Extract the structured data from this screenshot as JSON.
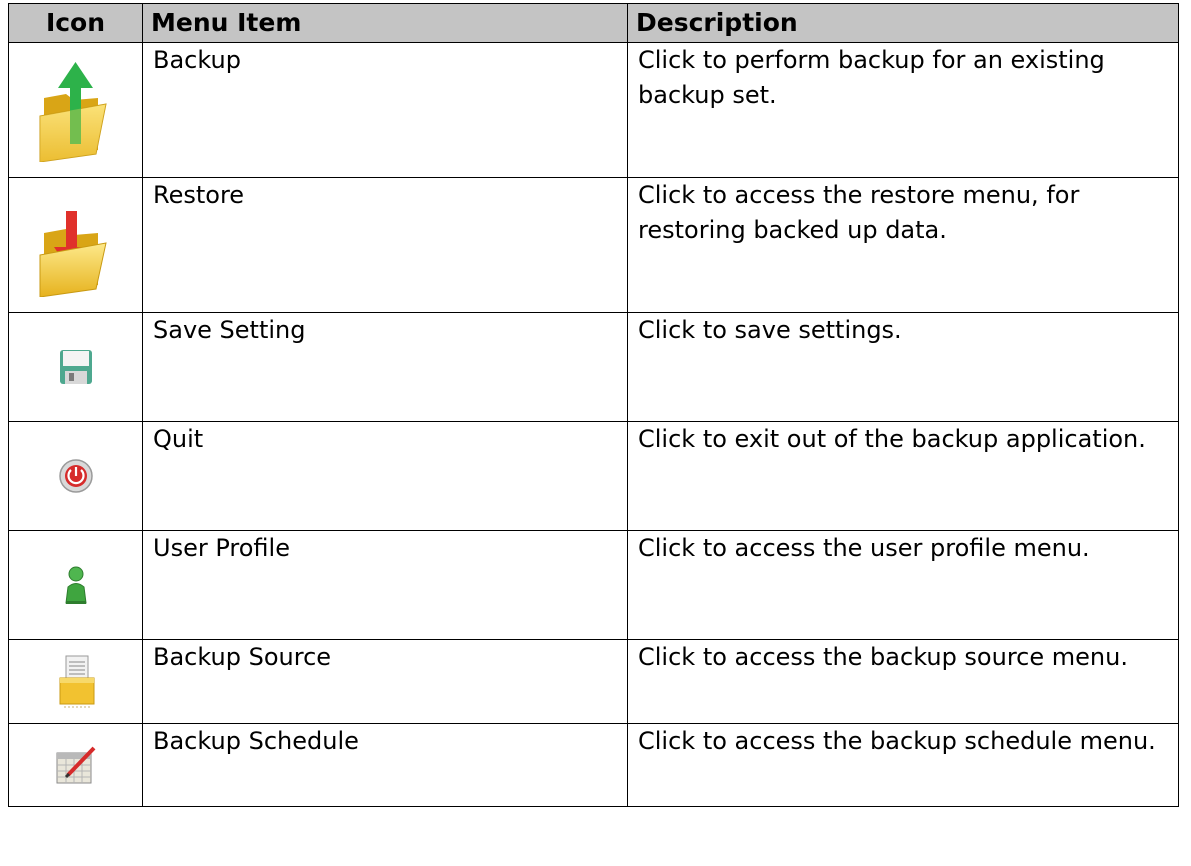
{
  "headers": {
    "icon": "Icon",
    "menu_item": "Menu Item",
    "description": "Description"
  },
  "rows": [
    {
      "icon": "backup-folder-icon",
      "item": "Backup",
      "description": "Click to perform backup for an existing backup set."
    },
    {
      "icon": "restore-folder-icon",
      "item": "Restore",
      "description": "Click to access the restore menu, for restoring backed up data."
    },
    {
      "icon": "floppy-disk-icon",
      "item": "Save Setting",
      "description": "Click to save settings."
    },
    {
      "icon": "power-button-icon",
      "item": "Quit",
      "description": "Click to exit out of the backup application."
    },
    {
      "icon": "user-icon",
      "item": "User Profile",
      "description": "Click to access the user profile menu."
    },
    {
      "icon": "document-folder-icon",
      "item": "Backup Source",
      "description": "Click to access the backup source menu."
    },
    {
      "icon": "calendar-pencil-icon",
      "item": "Backup Schedule",
      "description": "Click to access the backup schedule menu."
    }
  ],
  "colors": {
    "header_bg": "#c4c4c4",
    "folder": "#f2c230",
    "arrow_up": "#1fa83a",
    "arrow_down": "#e0302b",
    "disk": "#5bb29a",
    "power": "#d62b2b",
    "user": "#3fa53f"
  }
}
